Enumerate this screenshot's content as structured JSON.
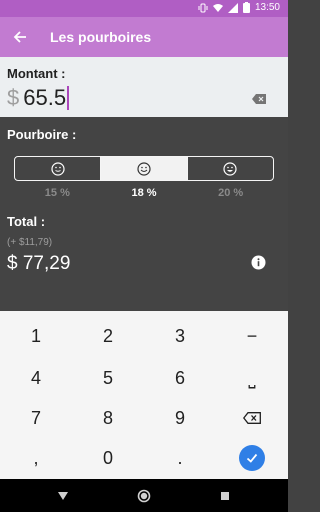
{
  "status_bar": {
    "time": "13:50"
  },
  "app_bar": {
    "title": "Les pourboires"
  },
  "amount": {
    "label": "Montant :",
    "currency": "$",
    "value": "65.5"
  },
  "tip": {
    "label": "Pourboire :",
    "options": [
      {
        "percent": "15 %",
        "icon": "slightly-smiling-face-icon"
      },
      {
        "percent": "18 %",
        "icon": "smiling-face-icon",
        "selected": true
      },
      {
        "percent": "20 %",
        "icon": "grinning-face-icon"
      }
    ]
  },
  "total": {
    "label": "Total :",
    "difference": "(+ $11,79)",
    "value": "$ 77,29"
  },
  "keypad": {
    "row1": [
      "1",
      "2",
      "3",
      "−"
    ],
    "row2": [
      "4",
      "5",
      "6",
      "⎵"
    ],
    "row3": [
      "7",
      "8",
      "9",
      "backspace-icon"
    ],
    "row4": [
      ",",
      "0",
      ".",
      "check-icon"
    ]
  },
  "colors": {
    "status_bar": "#b05ec4",
    "app_bar": "#c27bd1",
    "accent": "#2f7fe6"
  }
}
